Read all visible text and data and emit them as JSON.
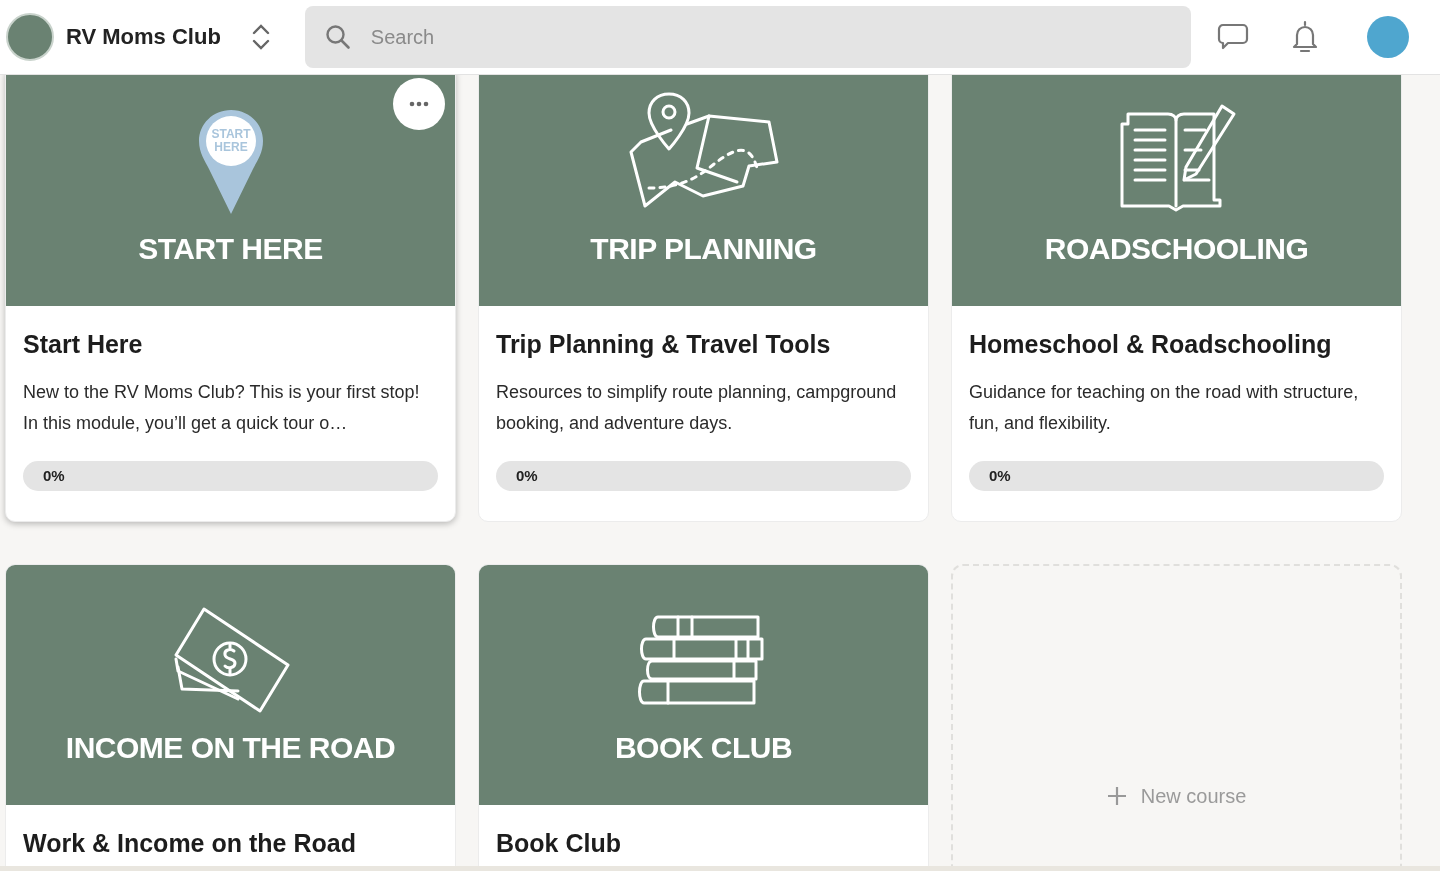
{
  "header": {
    "community": "RV Moms Club",
    "search": {
      "placeholder": "Search"
    }
  },
  "courses": [
    {
      "cover": {
        "kind": "pin",
        "pin_text": [
          "START",
          "HERE"
        ],
        "title": "START HERE"
      },
      "highlighted": true,
      "title": "Start Here",
      "description": "New to the RV Moms Club? This is your first stop! In this module, you’ll get a quick tour o…",
      "progress": {
        "label": "0%",
        "level": 0
      }
    },
    {
      "cover": {
        "kind": "map",
        "title": "TRIP PLANNING"
      },
      "highlighted": false,
      "title": "Trip Planning & Travel Tools",
      "description": "Resources to simplify route planning, campground booking, and adventure days.",
      "progress": {
        "label": "0%",
        "level": 0
      }
    },
    {
      "cover": {
        "kind": "book-pencil",
        "title": "ROADSCHOOLING"
      },
      "highlighted": false,
      "title": "Homeschool & Roadschooling",
      "description": "Guidance for teaching on the road with structure, fun, and flexibility.",
      "progress": {
        "label": "0%",
        "level": 0
      }
    },
    {
      "cover": {
        "kind": "money",
        "title": "INCOME ON THE ROAD"
      },
      "highlighted": false,
      "title": "Work & Income on the Road"
    },
    {
      "cover": {
        "kind": "books",
        "title": "BOOK CLUB"
      },
      "highlighted": false,
      "title": "Book Club"
    }
  ],
  "new_course": {
    "label": "New course"
  }
}
